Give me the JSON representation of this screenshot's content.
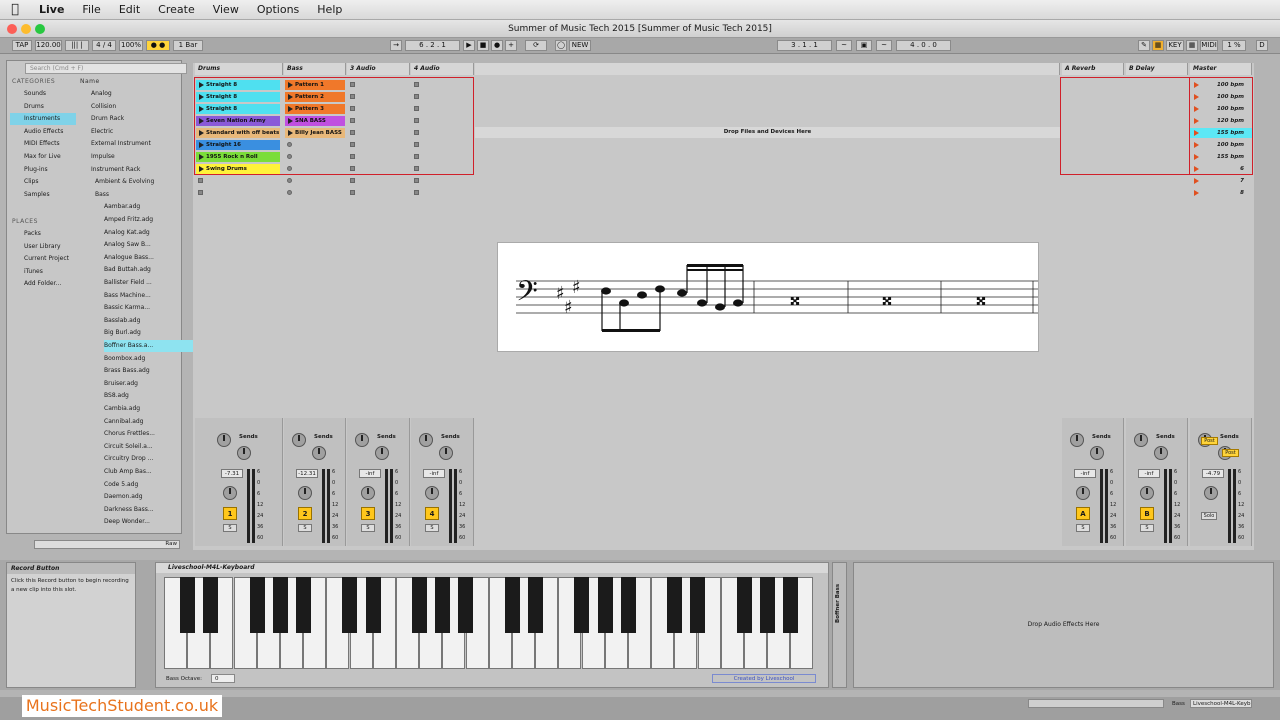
{
  "menubar": {
    "app": "Live",
    "items": [
      "File",
      "Edit",
      "Create",
      "View",
      "Options",
      "Help"
    ]
  },
  "window": {
    "title": "Summer of Music Tech 2015  [Summer of Music Tech 2015]"
  },
  "control_bar": {
    "tap": "TAP",
    "tempo": "120.00",
    "sig": "4 / 4",
    "zoom": "100%",
    "quant": "1 Bar",
    "arr_pos": "6 . 2 . 1",
    "new": "NEW",
    "loop_pos": "3 . 1 . 1",
    "loop_len": "4 . 0 . 0",
    "key": "KEY",
    "midi": "MIDI",
    "cpu": "1 %",
    "d": "D"
  },
  "browser": {
    "search_placeholder": "Search (Cmd + F)",
    "categories_header": "CATEGORIES",
    "name_header": "Name",
    "categories": [
      "Sounds",
      "Drums",
      "Instruments",
      "Audio Effects",
      "MIDI Effects",
      "Max for Live",
      "Plug-ins",
      "Clips",
      "Samples"
    ],
    "places_header": "PLACES",
    "places": [
      "Packs",
      "User Library",
      "Current Project",
      "iTunes",
      "Add Folder..."
    ],
    "items": [
      "Analog",
      "Collision",
      "Drum Rack",
      "Electric",
      "External Instrument",
      "Impulse",
      "Instrument Rack",
      "Ambient & Evolving",
      "Bass",
      "Aambar.adg",
      "Amped Fritz.adg",
      "Analog Kat.adg",
      "Analog Saw B...",
      "Analogue Bass...",
      "Bad Buttah.adg",
      "Ballister Field ...",
      "Bass Machine...",
      "Bassic Karma...",
      "Basslab.adg",
      "Big Burl.adg",
      "Boffner Bass.a...",
      "Boombox.adg",
      "Brass Bass.adg",
      "Bruiser.adg",
      "BS8.adg",
      "Cambia.adg",
      "Cannibal.adg",
      "Chorus Frettles...",
      "Circuit Soleil.a...",
      "Circuitry Drop ...",
      "Club Amp Bas...",
      "Code 5.adg",
      "Daemon.adg",
      "Darkness Bass...",
      "Deep Wonder..."
    ],
    "raw": "Raw"
  },
  "tracks": {
    "names": [
      "Drums",
      "Bass",
      "3 Audio",
      "4 Audio"
    ],
    "returns": [
      "A Reverb",
      "B Delay"
    ],
    "master": "Master",
    "drums_clips": [
      "Straight 8",
      "Straight 8",
      "Straight 8",
      "Seven Nation Army",
      "Standard with off beats",
      "Straight 16",
      "1955 Rock n Roll",
      "Swing Drums"
    ],
    "bass_clips": [
      "Pattern 1",
      "Pattern 2",
      "Pattern 3",
      "SNA BASS",
      "Billy Jean BASS"
    ],
    "drop_text": "Drop Files and Devices Here",
    "master_scenes": [
      "100 bpm",
      "100 bpm",
      "100 bpm",
      "120 bpm",
      "155 bpm",
      "100 bpm",
      "155 bpm",
      "6",
      "7",
      "8"
    ]
  },
  "mixer": {
    "sends": "Sends",
    "vols": [
      "-7.31",
      "-12.31",
      "-inf",
      "-inf",
      "-inf",
      "-inf",
      "-4.79"
    ],
    "nums": [
      "1",
      "2",
      "3",
      "4",
      "A",
      "B"
    ],
    "scale": [
      "6",
      "0",
      "6",
      "12",
      "24",
      "36",
      "60"
    ],
    "post": "Post",
    "solo": "S",
    "master_label": "Solo"
  },
  "info": {
    "title": "Record Button",
    "text": "Click this Record button to begin recording a new clip into this slot."
  },
  "device": {
    "name": "Liveschool-M4L-Keyboard",
    "octave_label": "Bass Octave:",
    "octave": "0",
    "credit": "Created by Liveschool",
    "rack_label": "Boffner Bass",
    "audio_drop": "Drop Audio Effects Here"
  },
  "status": {
    "track": "Bass",
    "device": "Liveschool-M4L-Keyb"
  },
  "brand": "MusicTechStudent.co.uk",
  "colors": {
    "cyan": "#4fe0f0",
    "orange": "#f0782a",
    "purple": "#8a5ad8",
    "green": "#7bdd3a",
    "yellow": "#fff23a",
    "blue": "#3a8fe0",
    "tan": "#e8b87a",
    "magenta": "#c050e0"
  }
}
